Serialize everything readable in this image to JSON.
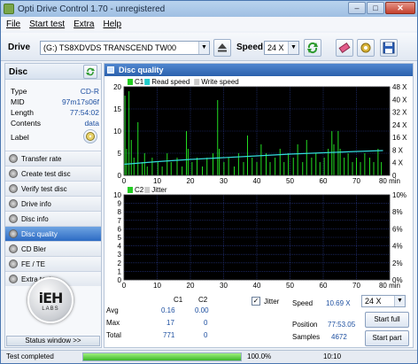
{
  "window": {
    "title": "Opti Drive Control 1.70 - unregistered",
    "minimize_label": "–",
    "maximize_label": "□",
    "close_label": "✕"
  },
  "menu": {
    "file": "File",
    "start_test": "Start test",
    "extra": "Extra",
    "help": "Help"
  },
  "toolbar": {
    "drive_label": "Drive",
    "drive_value": "(G:)  TS8XDVDS TRANSCEND TW00",
    "speed_label": "Speed",
    "speed_value": "24 X"
  },
  "disc": {
    "header": "Disc",
    "rows": [
      {
        "label": "Type",
        "value": "CD-R"
      },
      {
        "label": "MID",
        "value": "97m17s06f"
      },
      {
        "label": "Length",
        "value": "77:54:02"
      },
      {
        "label": "Contents",
        "value": "data"
      },
      {
        "label": "Label",
        "value": ""
      }
    ]
  },
  "nav": {
    "items": [
      {
        "label": "Transfer rate"
      },
      {
        "label": "Create test disc"
      },
      {
        "label": "Verify test disc"
      },
      {
        "label": "Drive info"
      },
      {
        "label": "Disc info"
      },
      {
        "label": "Disc quality"
      },
      {
        "label": "CD Bler"
      },
      {
        "label": "FE / TE"
      },
      {
        "label": "Extra tests"
      }
    ],
    "active_index": 5
  },
  "logo": {
    "big": "iEH",
    "small": "LABS"
  },
  "status_window_label": "Status window >>",
  "main": {
    "header": "Disc quality"
  },
  "chart_data": [
    {
      "type": "bar",
      "legend": [
        "C1",
        "Read speed",
        "Write speed"
      ],
      "legend_colors": [
        "#22cc22",
        "#22cccc",
        "#cccccc"
      ],
      "xlim": [
        0,
        80
      ],
      "x_ticks": [
        "0",
        "10",
        "20",
        "30",
        "40",
        "50",
        "60",
        "70",
        "80 min"
      ],
      "ylim": [
        0,
        20
      ],
      "y_ticks": [
        "0",
        "5",
        "10",
        "15",
        "20"
      ],
      "y2_ticks": [
        "0",
        "4 X",
        "8 X",
        "16 X",
        "24 X",
        "32 X",
        "40 X",
        "48 X"
      ],
      "c1_spikes": [
        {
          "x": 0.3,
          "y": 18
        },
        {
          "x": 0.8,
          "y": 6
        },
        {
          "x": 1.5,
          "y": 19
        },
        {
          "x": 2.2,
          "y": 8
        },
        {
          "x": 3.0,
          "y": 4
        },
        {
          "x": 4.2,
          "y": 12
        },
        {
          "x": 5.5,
          "y": 3
        },
        {
          "x": 6.2,
          "y": 5
        },
        {
          "x": 7.0,
          "y": 2
        },
        {
          "x": 8.5,
          "y": 4
        },
        {
          "x": 10.2,
          "y": 3
        },
        {
          "x": 11.5,
          "y": 2
        },
        {
          "x": 13.0,
          "y": 5
        },
        {
          "x": 14.2,
          "y": 3
        },
        {
          "x": 16.0,
          "y": 4
        },
        {
          "x": 17.5,
          "y": 2
        },
        {
          "x": 18.8,
          "y": 10
        },
        {
          "x": 19.3,
          "y": 6
        },
        {
          "x": 20.5,
          "y": 3
        },
        {
          "x": 22.0,
          "y": 4
        },
        {
          "x": 23.6,
          "y": 2
        },
        {
          "x": 25.0,
          "y": 4
        },
        {
          "x": 26.8,
          "y": 5
        },
        {
          "x": 28.2,
          "y": 17
        },
        {
          "x": 28.7,
          "y": 6
        },
        {
          "x": 30.1,
          "y": 3
        },
        {
          "x": 31.5,
          "y": 4
        },
        {
          "x": 33.2,
          "y": 2
        },
        {
          "x": 34.5,
          "y": 5
        },
        {
          "x": 36.0,
          "y": 3
        },
        {
          "x": 37.2,
          "y": 9
        },
        {
          "x": 38.6,
          "y": 4
        },
        {
          "x": 40.0,
          "y": 3
        },
        {
          "x": 41.3,
          "y": 7
        },
        {
          "x": 42.8,
          "y": 5
        },
        {
          "x": 44.0,
          "y": 3
        },
        {
          "x": 45.5,
          "y": 4
        },
        {
          "x": 47.0,
          "y": 6
        },
        {
          "x": 48.2,
          "y": 3
        },
        {
          "x": 49.5,
          "y": 5
        },
        {
          "x": 51.0,
          "y": 4
        },
        {
          "x": 52.3,
          "y": 7
        },
        {
          "x": 53.8,
          "y": 3
        },
        {
          "x": 55.0,
          "y": 8
        },
        {
          "x": 56.5,
          "y": 4
        },
        {
          "x": 57.8,
          "y": 5
        },
        {
          "x": 59.0,
          "y": 3
        },
        {
          "x": 60.3,
          "y": 4
        },
        {
          "x": 61.5,
          "y": 6
        },
        {
          "x": 62.6,
          "y": 10
        },
        {
          "x": 63.2,
          "y": 7
        },
        {
          "x": 64.5,
          "y": 10
        },
        {
          "x": 65.1,
          "y": 6
        },
        {
          "x": 66.3,
          "y": 4
        },
        {
          "x": 67.5,
          "y": 5
        },
        {
          "x": 68.8,
          "y": 3
        },
        {
          "x": 70.0,
          "y": 4
        },
        {
          "x": 71.2,
          "y": 3
        },
        {
          "x": 72.5,
          "y": 5
        },
        {
          "x": 74.0,
          "y": 4
        },
        {
          "x": 75.2,
          "y": 3
        },
        {
          "x": 76.5,
          "y": 6
        },
        {
          "x": 77.5,
          "y": 3
        }
      ],
      "read_speed_line": [
        {
          "x": 0,
          "y": 2.5
        },
        {
          "x": 10,
          "y": 3.1
        },
        {
          "x": 20,
          "y": 3.6
        },
        {
          "x": 30,
          "y": 4.0
        },
        {
          "x": 40,
          "y": 4.4
        },
        {
          "x": 50,
          "y": 4.8
        },
        {
          "x": 60,
          "y": 5.1
        },
        {
          "x": 70,
          "y": 5.4
        },
        {
          "x": 78,
          "y": 5.6
        }
      ],
      "bg_color": "#000000"
    },
    {
      "type": "bar",
      "legend": [
        "C2",
        "Jitter"
      ],
      "legend_colors": [
        "#22cc22",
        "#cccccc"
      ],
      "xlim": [
        0,
        80
      ],
      "x_ticks": [
        "0",
        "10",
        "20",
        "30",
        "40",
        "50",
        "60",
        "70",
        "80 min"
      ],
      "ylim": [
        0,
        10
      ],
      "y_ticks": [
        "0",
        "1",
        "2",
        "3",
        "4",
        "5",
        "6",
        "7",
        "8",
        "9",
        "10"
      ],
      "y2_ticks": [
        "0%",
        "2%",
        "4%",
        "6%",
        "8%",
        "10%"
      ],
      "values": [],
      "bg_color": "#000000"
    }
  ],
  "stats": {
    "col_c1": "C1",
    "col_c2": "C2",
    "rows": [
      {
        "label": "Avg",
        "c1": "0.16",
        "c2": "0.00"
      },
      {
        "label": "Max",
        "c1": "17",
        "c2": "0"
      },
      {
        "label": "Total",
        "c1": "771",
        "c2": "0"
      }
    ],
    "jitter_label": "Jitter",
    "jitter_checked": "✓",
    "speed_label": "Speed",
    "speed_value": "10.69 X",
    "speed_select": "24 X",
    "position_label": "Position",
    "position_value": "77:53.05",
    "samples_label": "Samples",
    "samples_value": "4672",
    "start_full": "Start full",
    "start_part": "Start part"
  },
  "statusbar": {
    "text": "Test completed",
    "progress_percent": 100,
    "progress_label": "100.0%",
    "time": "10:10"
  }
}
